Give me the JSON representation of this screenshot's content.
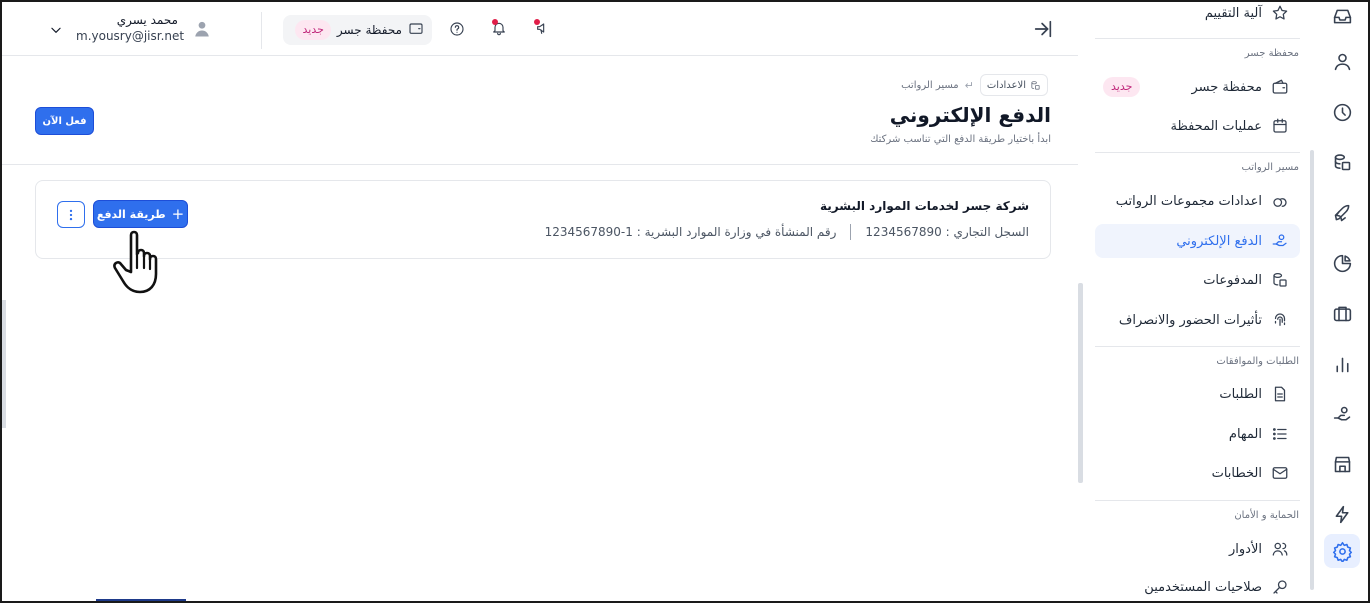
{
  "sidebar": {
    "top_item": "آلية التقييم",
    "sections": [
      {
        "title": "محفظة جسر",
        "items": [
          {
            "label": "محفظة جسر",
            "badge": "جديد",
            "icon": "wallet-icon"
          },
          {
            "label": "عمليات المحفظة",
            "icon": "calendar-icon"
          }
        ]
      },
      {
        "title": "مسير الرواتب",
        "items": [
          {
            "label": "اعدادات مجموعات الرواتب",
            "icon": "puzzle-icon"
          },
          {
            "label": "الدفع الإلكتروني",
            "icon": "hand-coins-icon",
            "active": true
          },
          {
            "label": "المدفوعات",
            "icon": "coins-icon"
          },
          {
            "label": "تأثيرات الحضور والانصراف",
            "icon": "fingerprint-icon"
          }
        ]
      },
      {
        "title": "الطلبات والموافقات",
        "items": [
          {
            "label": "الطلبات",
            "icon": "document-icon"
          },
          {
            "label": "المهام",
            "icon": "list-icon"
          },
          {
            "label": "الخطابات",
            "icon": "mail-icon"
          }
        ]
      },
      {
        "title": "الحماية و الأمان",
        "items": [
          {
            "label": "الأدوار",
            "icon": "users-icon"
          },
          {
            "label": "صلاحيات المستخدمين",
            "icon": "key-icon"
          }
        ]
      }
    ]
  },
  "topbar": {
    "wallet_label": "محفظة جسر",
    "wallet_badge": "جديد",
    "user_name": "محمد يسري",
    "user_email": "m.yousry@jisr.net"
  },
  "breadcrumb": {
    "root": "الاعدادات",
    "current": "مسير الرواتب"
  },
  "page": {
    "title": "الدفع الإلكتروني",
    "subtitle": "ابدأ باختيار طريقة الدفع التي تناسب شركتك",
    "activate_button": "فعل الآن"
  },
  "company": {
    "name": "شركة جسر لخدمات الموارد البشرية",
    "commercial_register": "السجل التجاري : 1234567890",
    "hr_ministry_number": "رقم المنشأة في وزارة الموارد البشرية : 1-1234567890",
    "add_method_button": "طريقة الدفع",
    "add_plus": "+"
  },
  "colors": {
    "accent": "#2f6fed",
    "badge_bg": "#fde7f1",
    "badge_text": "#c0267a",
    "notification_dot": "#e11d48"
  }
}
